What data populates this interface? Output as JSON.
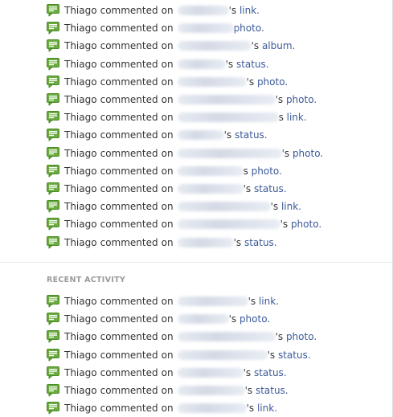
{
  "colors": {
    "link": "#3b5998",
    "text": "#333333",
    "heading": "#9a9a9a",
    "icon": "#6bab3f"
  },
  "icon_name": "comment-bubble-icon",
  "top_feed": [
    {
      "actor": "Thiago",
      "verb": "commented",
      "on": "on",
      "object": "link.",
      "possessive": "'s "
    },
    {
      "actor": "Thiago",
      "verb": "commented",
      "on": "on",
      "object": "photo.",
      "possessive": " "
    },
    {
      "actor": "Thiago",
      "verb": "commented",
      "on": "on",
      "object": "album.",
      "possessive": "'s "
    },
    {
      "actor": "Thiago",
      "verb": "commented",
      "on": "on",
      "object": "status.",
      "possessive": "'s "
    },
    {
      "actor": "Thiago",
      "verb": "commented",
      "on": "on",
      "object": "photo.",
      "possessive": "'s "
    },
    {
      "actor": "Thiago",
      "verb": "commented",
      "on": "on",
      "object": "photo.",
      "possessive": "'s "
    },
    {
      "actor": "Thiago",
      "verb": "commented",
      "on": "on",
      "object": "link.",
      "possessive": "s "
    },
    {
      "actor": "Thiago",
      "verb": "commented",
      "on": "on",
      "object": "status.",
      "possessive": "'s "
    },
    {
      "actor": "Thiago",
      "verb": "commented",
      "on": "on",
      "object": "photo.",
      "possessive": "'s "
    },
    {
      "actor": "Thiago",
      "verb": "commented",
      "on": "on",
      "object": "photo.",
      "possessive": "s "
    },
    {
      "actor": "Thiago",
      "verb": "commented",
      "on": "on",
      "object": "status.",
      "possessive": "'s "
    },
    {
      "actor": "Thiago",
      "verb": "commented",
      "on": "on",
      "object": "link.",
      "possessive": "'s "
    },
    {
      "actor": "Thiago",
      "verb": "commented",
      "on": "on",
      "object": "photo.",
      "possessive": "'s "
    },
    {
      "actor": "Thiago",
      "verb": "commented",
      "on": "on",
      "object": "status.",
      "possessive": "'s "
    }
  ],
  "recent_activity": {
    "heading": "RECENT ACTIVITY",
    "items": [
      {
        "actor": "Thiago",
        "verb": "commented",
        "on": "on",
        "object": "link.",
        "possessive": "'s "
      },
      {
        "actor": "Thiago",
        "verb": "commented",
        "on": "on",
        "object": "photo.",
        "possessive": "'s "
      },
      {
        "actor": "Thiago",
        "verb": "commented",
        "on": "on",
        "object": "photo.",
        "possessive": "'s "
      },
      {
        "actor": "Thiago",
        "verb": "commented",
        "on": "on",
        "object": "status.",
        "possessive": "'s "
      },
      {
        "actor": "Thiago",
        "verb": "commented",
        "on": "on",
        "object": "status.",
        "possessive": "'s "
      },
      {
        "actor": "Thiago",
        "verb": "commented",
        "on": "on",
        "object": "status.",
        "possessive": "'s "
      },
      {
        "actor": "Thiago",
        "verb": "commented",
        "on": "on",
        "object": "link.",
        "possessive": "'s "
      }
    ]
  }
}
